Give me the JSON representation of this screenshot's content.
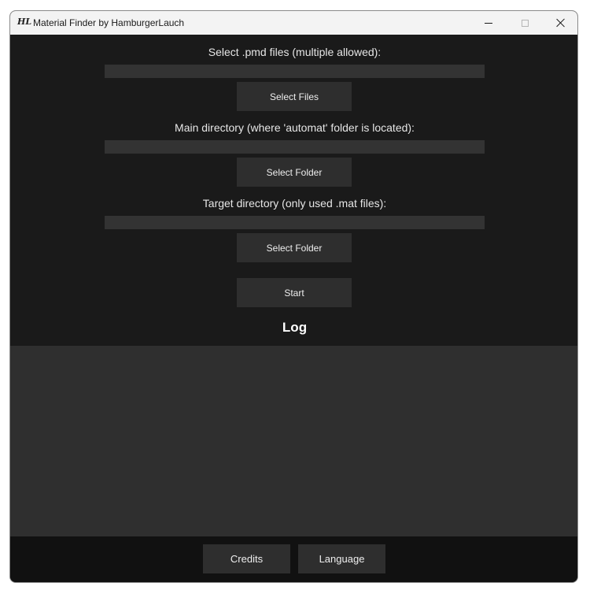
{
  "window": {
    "title": "Material Finder by HamburgerLauch",
    "icon_text": "HL"
  },
  "pmd": {
    "label": "Select .pmd files (multiple allowed):",
    "value": "",
    "button": "Select Files"
  },
  "main_dir": {
    "label": "Main directory (where 'automat' folder is located):",
    "value": "",
    "button": "Select Folder"
  },
  "target_dir": {
    "label": "Target directory (only used .mat files):",
    "value": "",
    "button": "Select Folder"
  },
  "start_button": "Start",
  "log": {
    "heading": "Log",
    "content": ""
  },
  "footer": {
    "credits": "Credits",
    "language": "Language"
  },
  "colors": {
    "background": "#1a1a1a",
    "field": "#333333",
    "button": "#2e2e2e",
    "log_area": "#2f2f2f",
    "footer": "#111111",
    "titlebar": "#f3f3f3"
  }
}
